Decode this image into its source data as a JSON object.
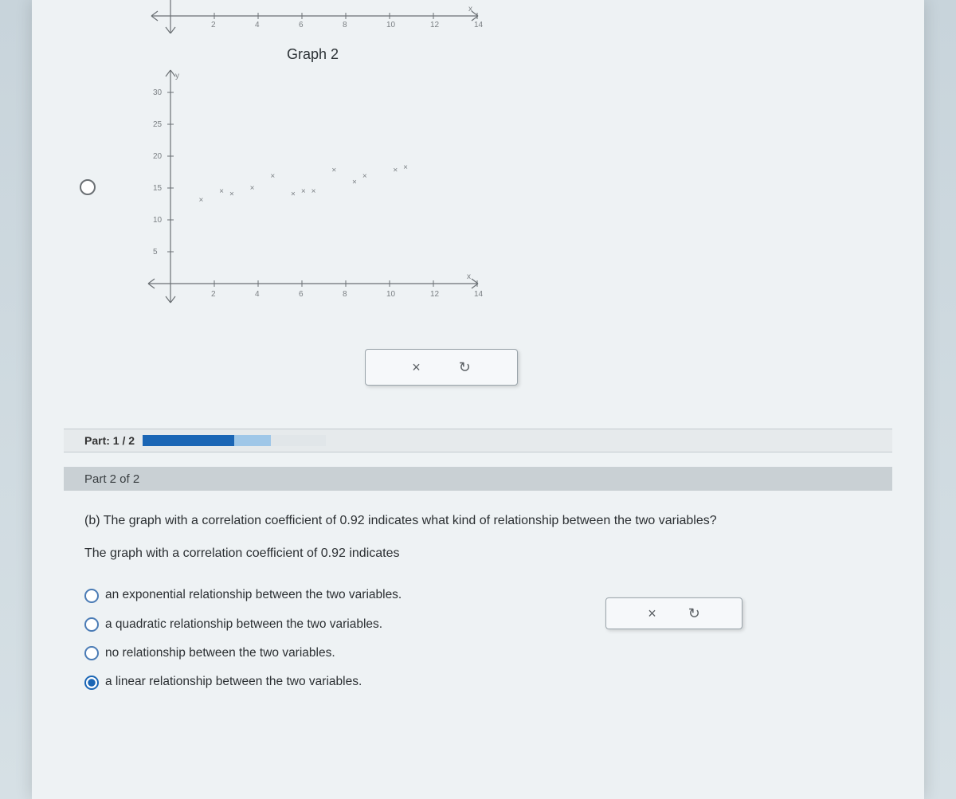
{
  "top_axis": {
    "ticks": [
      "2",
      "4",
      "6",
      "8",
      "10",
      "12",
      "14"
    ],
    "varlabel": "x"
  },
  "graph": {
    "title": "Graph 2",
    "ylabel": "y",
    "xlabel": "x",
    "yticks": [
      "30",
      "25",
      "20",
      "15",
      "10",
      "5"
    ],
    "xticks": [
      "2",
      "4",
      "6",
      "8",
      "10",
      "12",
      "14"
    ]
  },
  "chart_data": {
    "type": "scatter",
    "title": "Graph 2",
    "xlabel": "x",
    "ylabel": "y",
    "xlim": [
      0,
      15
    ],
    "ylim": [
      0,
      32
    ],
    "points": [
      {
        "x": 1.5,
        "y": 14
      },
      {
        "x": 2.5,
        "y": 15.5
      },
      {
        "x": 3,
        "y": 15
      },
      {
        "x": 4,
        "y": 16
      },
      {
        "x": 5,
        "y": 18
      },
      {
        "x": 6,
        "y": 15
      },
      {
        "x": 6.5,
        "y": 15.5
      },
      {
        "x": 7,
        "y": 15.5
      },
      {
        "x": 8,
        "y": 19
      },
      {
        "x": 9,
        "y": 17
      },
      {
        "x": 9.5,
        "y": 18
      },
      {
        "x": 11,
        "y": 19
      },
      {
        "x": 11.5,
        "y": 19.5
      }
    ]
  },
  "toolbar": {
    "clear": "×",
    "reset": "↻"
  },
  "progress": {
    "label": "Part: 1 / 2"
  },
  "part_header": "Part 2 of 2",
  "question": {
    "prompt": "(b) The graph with a correlation coefficient of 0.92 indicates what kind of relationship between the two variables?",
    "stem2": "The graph with a correlation coefficient of 0.92 indicates",
    "options": [
      "an exponential relationship between the two variables.",
      "a quadratic relationship between the two variables.",
      "no relationship between the two variables.",
      "a linear relationship between the two variables."
    ],
    "selected_index": 3
  }
}
